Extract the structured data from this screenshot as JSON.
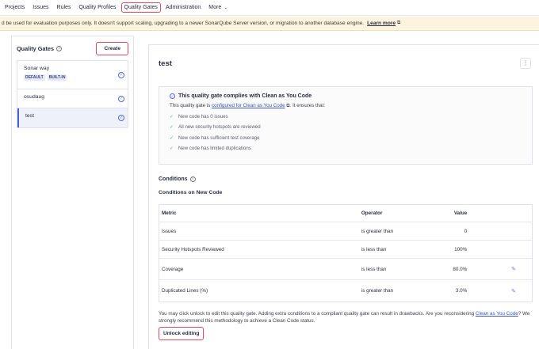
{
  "nav": {
    "items": [
      "Projects",
      "Issues",
      "Rules",
      "Quality Profiles",
      "Quality Gates",
      "Administration",
      "More"
    ],
    "active": "Quality Gates"
  },
  "banner": {
    "text": "d be used for evaluation purposes only. It doesn't support scaling, upgrading to a newer SonarQube Server version, or migration to another database engine.",
    "link": "Learn more"
  },
  "sidebar": {
    "title": "Quality Gates",
    "create_label": "Create",
    "gates": [
      {
        "name": "Sonar way",
        "badges": [
          "DEFAULT",
          "BUILT-IN"
        ]
      },
      {
        "name": "osudaug",
        "badges": []
      },
      {
        "name": "test",
        "badges": []
      }
    ],
    "selected": "test"
  },
  "main": {
    "title": "test",
    "cayc": {
      "heading": "This quality gate complies with Clean as You Code",
      "desc_prefix": "This quality gate is",
      "desc_link": "configured for Clean as You Code",
      "desc_suffix": ". It ensures that:",
      "items": [
        "New code has 0 issues",
        "All new security hotspots are reviewed",
        "New code has sufficient test coverage",
        "New code has limited duplications"
      ]
    },
    "conditions_title": "Conditions",
    "conditions_sub": "Conditions on New Code",
    "table": {
      "headers": [
        "Metric",
        "Operator",
        "Value"
      ],
      "rows": [
        {
          "metric": "Issues",
          "operator": "is greater than",
          "value": "0",
          "editable": false
        },
        {
          "metric": "Security Hotspots Reviewed",
          "operator": "is less than",
          "value": "100%",
          "editable": false
        },
        {
          "metric": "Coverage",
          "operator": "is less than",
          "value": "80.0%",
          "editable": true
        },
        {
          "metric": "Duplicated Lines (%)",
          "operator": "is greater than",
          "value": "3.0%",
          "editable": true
        }
      ]
    },
    "notice_prefix": "You may click unlock to edit this quality gate. Adding extra conditions to a compliant quality gate can result in drawbacks. Are you reconsidering",
    "notice_link": "Clean as You Code",
    "notice_suffix": "? We strongly recommend this methodology to achieve a Clean Code status.",
    "unlock_label": "Unlock editing"
  },
  "colors": {
    "highlight": "#e0485f",
    "accent": "#4a5fd0",
    "banner_bg": "#fcf4df",
    "check_green": "#4ea86b"
  },
  "icons": [
    "info-icon",
    "check-circle-icon",
    "external-link-icon",
    "kebab-icon",
    "checkmark-icon",
    "pencil-icon",
    "chevron-down-icon"
  ]
}
